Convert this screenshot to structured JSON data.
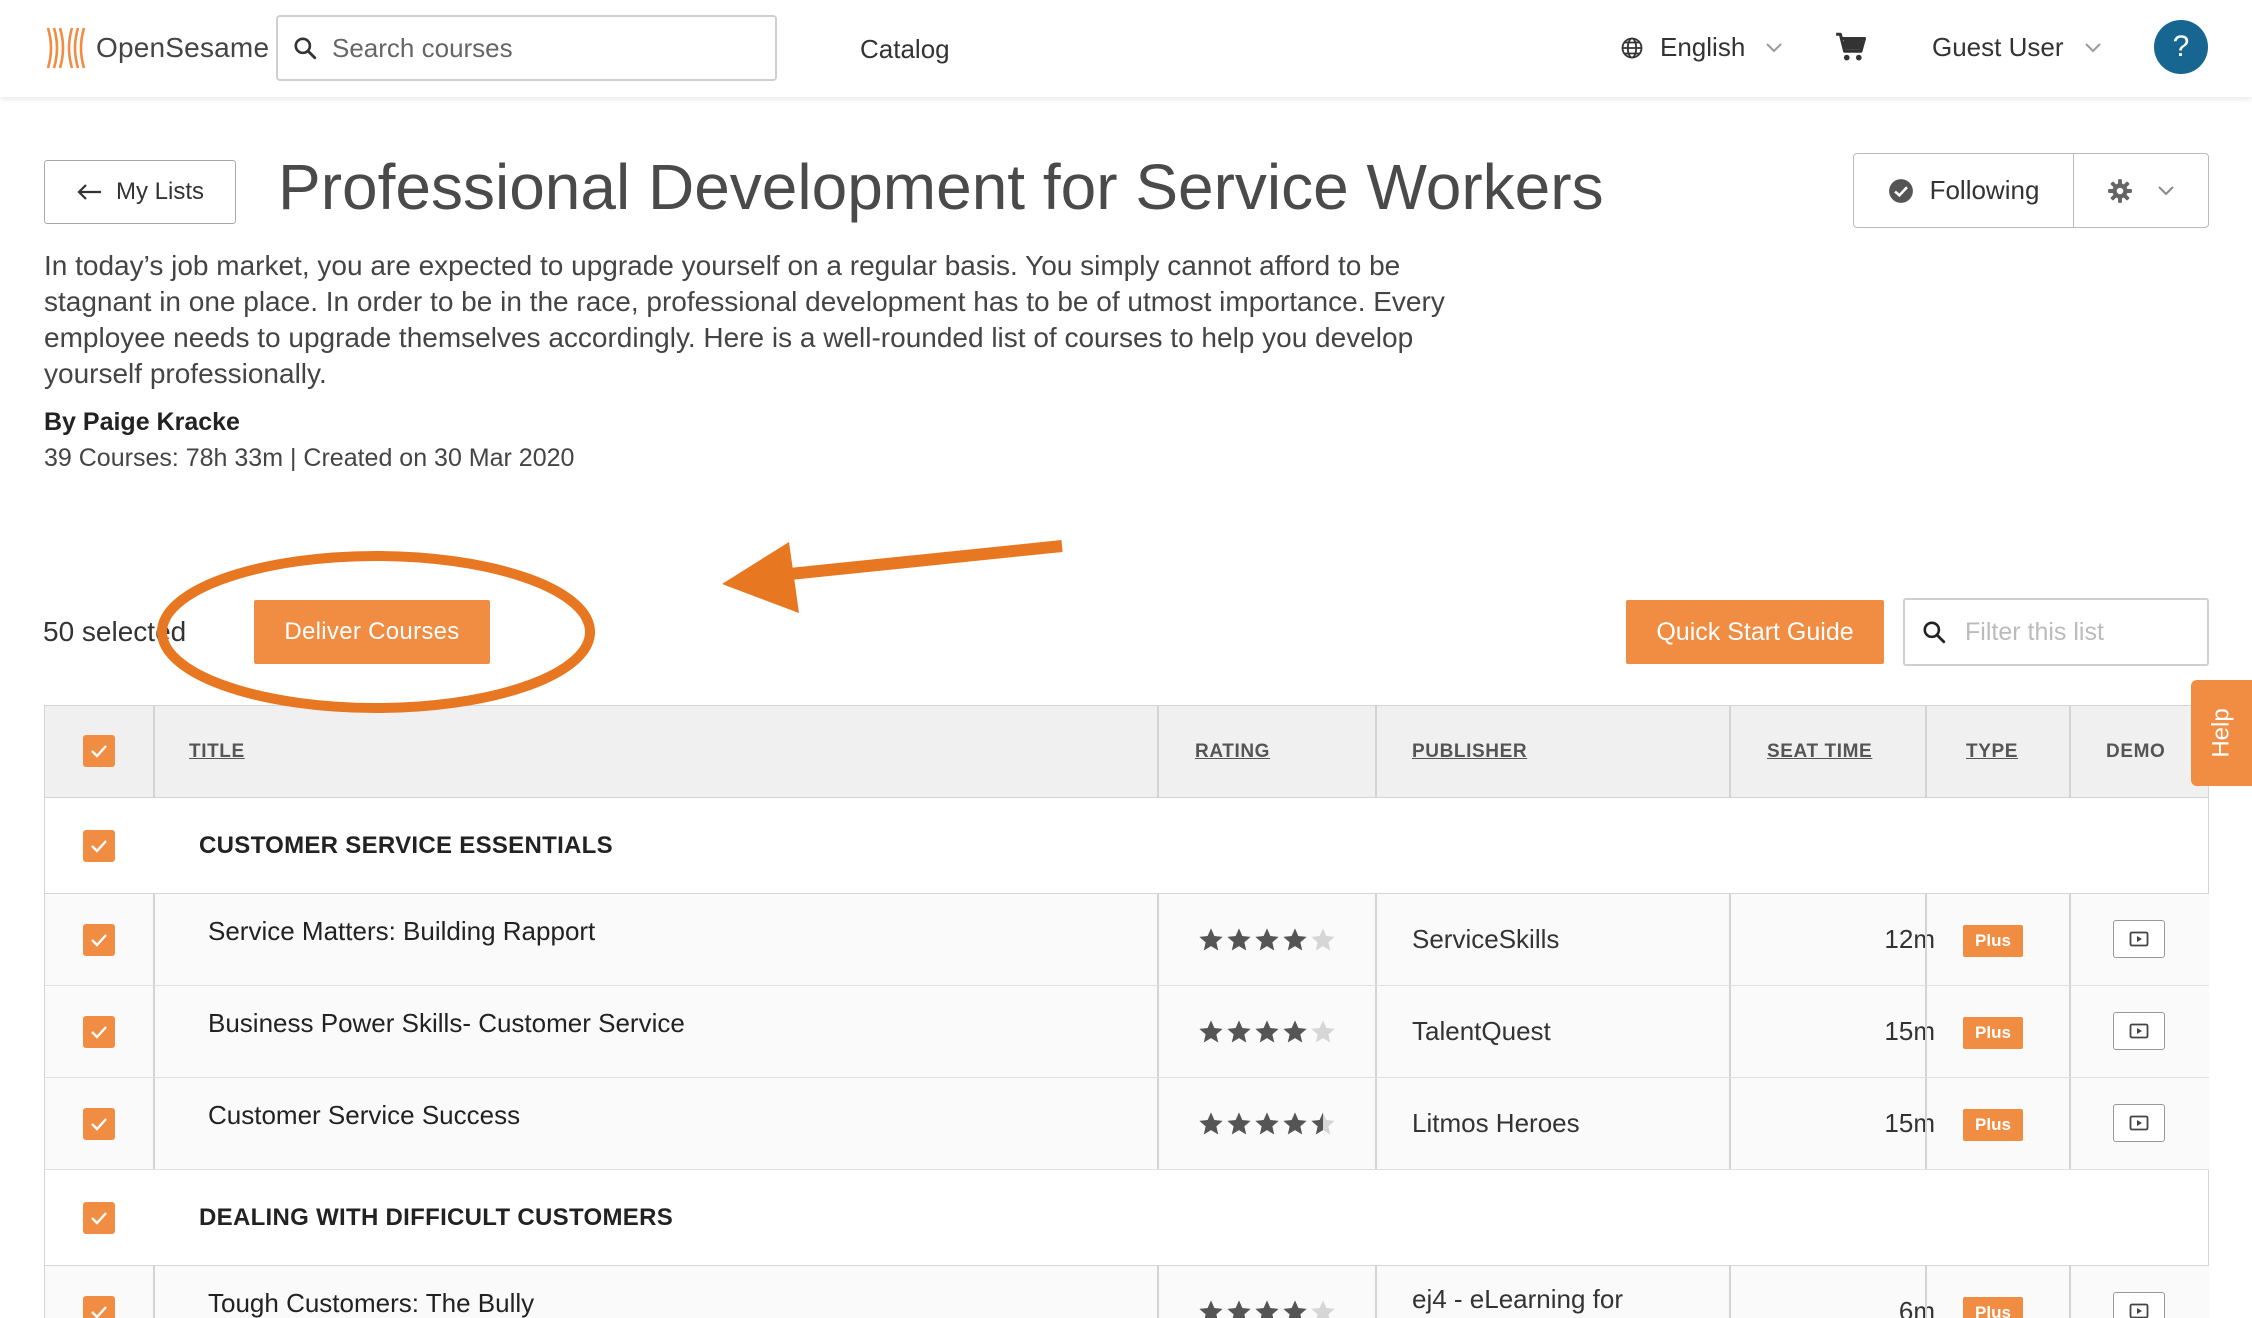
{
  "header": {
    "logo_text": "OpenSesame",
    "search_placeholder": "Search courses",
    "nav_catalog": "Catalog",
    "language": "English",
    "user": "Guest User",
    "help_symbol": "?"
  },
  "page": {
    "back_label": "My Lists",
    "title": "Professional Development for Service Workers",
    "follow_label": "Following",
    "description": "In today’s job market, you are expected to upgrade yourself on a regular basis. You simply cannot afford to be stagnant in one place. In order to be in the race, professional development has to be of utmost importance. Every employee needs to upgrade themselves accordingly. Here is a well-rounded list of courses to help you develop yourself professionally.",
    "author": "By Paige Kracke",
    "meta": "39 Courses: 78h 33m | Created on 30 Mar 2020"
  },
  "toolbar": {
    "selected_count": "50 selected",
    "deliver_label": "Deliver Courses",
    "quick_start_label": "Quick Start Guide",
    "filter_placeholder": "Filter this list",
    "side_help_label": "Help"
  },
  "table": {
    "columns": {
      "title": "TITLE",
      "rating": "RATING",
      "publisher": "PUBLISHER",
      "seat_time": "SEAT TIME",
      "type": "TYPE",
      "demo": "DEMO"
    },
    "groups": [
      {
        "name": "CUSTOMER SERVICE ESSENTIALS",
        "rows": [
          {
            "title": "Service Matters: Building Rapport",
            "rating": 4,
            "publisher": "ServiceSkills",
            "seat_time": "12m",
            "type": "Plus"
          },
          {
            "title": "Business Power Skills- Customer Service",
            "rating": 4,
            "publisher": "TalentQuest",
            "seat_time": "15m",
            "type": "Plus"
          },
          {
            "title": "Customer Service Success",
            "rating": 4.5,
            "publisher": "Litmos Heroes",
            "seat_time": "15m",
            "type": "Plus"
          }
        ]
      },
      {
        "name": "DEALING WITH DIFFICULT CUSTOMERS",
        "rows": [
          {
            "title": "Tough Customers: The Bully",
            "rating": 4,
            "publisher": "ej4 - eLearning for",
            "seat_time": "6m",
            "type": "Plus"
          }
        ]
      }
    ]
  },
  "icons": {
    "search": "search-icon",
    "globe": "globe-icon",
    "cart": "cart-icon",
    "check": "check-icon",
    "gear": "gear-icon",
    "demo": "play-icon"
  },
  "colors": {
    "accent": "#f18c43",
    "help_blue": "#176691",
    "annotation": "#e87722"
  }
}
